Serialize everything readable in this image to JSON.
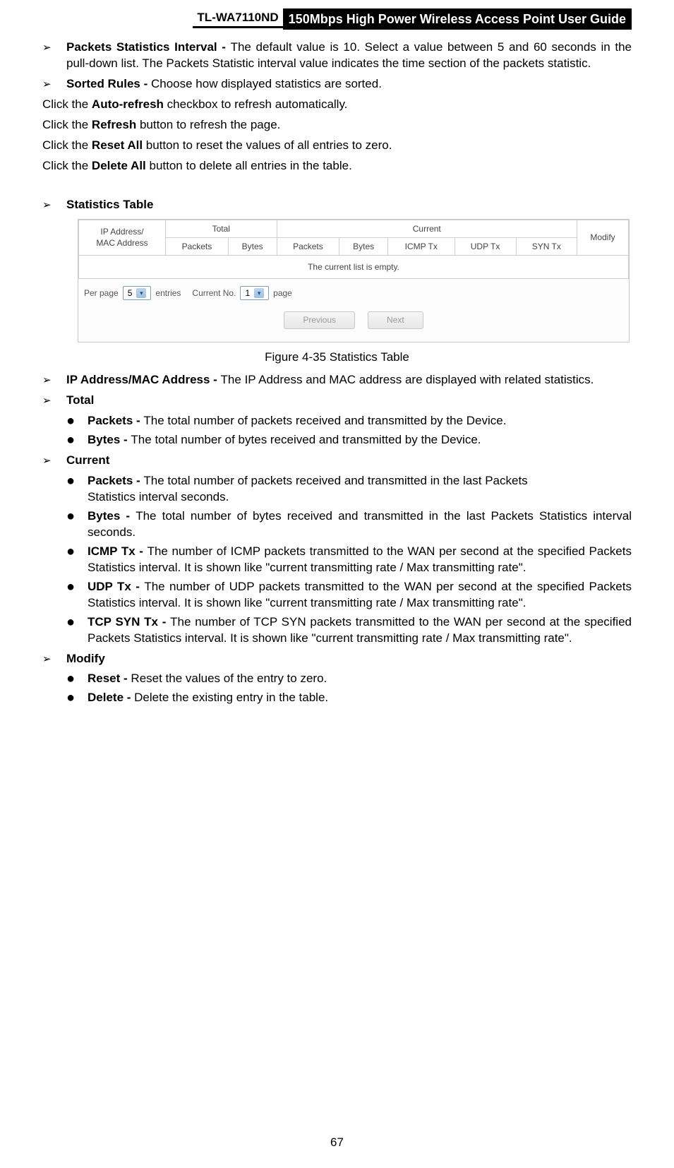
{
  "header": {
    "model": "TL-WA7110ND",
    "title": "150Mbps High Power Wireless Access Point User Guide"
  },
  "items": {
    "pkstats": {
      "label": "Packets  Statistics  Interval  - ",
      "text": "The  default  value  is  10.  Select  a  value  between 5   and    60  seconds  in  the  pull-down  list.  The  Packets  Statistic  interval  value  indicates  the time section of the packets statistic."
    },
    "sorted": {
      "label": "Sorted Rules - ",
      "text": "Choose how displayed statistics are sorted."
    }
  },
  "notes": {
    "autorefresh": {
      "pre": "Click the ",
      "bold": "Auto-refresh",
      "post": " checkbox to refresh automatically."
    },
    "refresh": {
      "pre": "Click the ",
      "bold": "Refresh",
      "post": " button to refresh the page."
    },
    "resetall": {
      "pre": "Click the ",
      "bold": "Reset All",
      "post": " button to reset the values of all entries to zero."
    },
    "deleteall": {
      "pre": "Click the ",
      "bold": "Delete All",
      "post": " button to delete all entries in the table."
    }
  },
  "stats_heading": "Statistics Table",
  "table": {
    "h_ip": "IP Address/\nMAC Address",
    "h_total": "Total",
    "h_current": "Current",
    "h_modify": "Modify",
    "h_packets": "Packets",
    "h_bytes": "Bytes",
    "h_icmp": "ICMP Tx",
    "h_udp": "UDP Tx",
    "h_syn": "SYN Tx",
    "empty": "The current list is empty.",
    "per_page": "Per page",
    "per_page_val": "5",
    "entries": "entries",
    "cur_no": "Current No.",
    "cur_no_val": "1",
    "page": "page",
    "prev": "Previous",
    "next": "Next"
  },
  "figure_caption": "Figure 4-35 Statistics Table",
  "desc": {
    "ipmac": {
      "label": "IP Address/MAC Address - ",
      "text": "The IP Address and MAC address are displayed with related statistics."
    },
    "total_head": "Total",
    "total_packets": {
      "label": "Packets - ",
      "text": "The total number of packets received and transmitted by the Device."
    },
    "total_bytes": {
      "label": "Bytes - ",
      "text": "The total number of bytes received and transmitted by the Device."
    },
    "current_head": "Current",
    "cur_packets": {
      "label": "Packets   -  ",
      "text1": "The   total   number   of   packets   received   and   transmitted   in   the last   Packets",
      "text2": "Statistics interval seconds."
    },
    "cur_bytes": {
      "label": "Bytes - ",
      "text": "The total number of bytes received and transmitted in the last Packets Statistics interval seconds."
    },
    "cur_icmp": {
      "label": "ICMP   Tx   -  ",
      "text": "The   number   of   ICMP   packets   transmitted   to   the   WAN   per second   at   the specified    Packets    Statistics    interval.   It   is   shown   like   \"current transmitting    rate    /    Max transmitting rate\"."
    },
    "cur_udp": {
      "label": "UDP  Tx  -  ",
      "text": "The  number  of  UDP  packets  transmitted  to  the  WAN  per  second  at  the specified Packets   Statistics   interval.   It   is   shown   like   \"current   transmitting   rate   / Max   transmitting rate\"."
    },
    "cur_tcp": {
      "label": "TCP  SYN  Tx  -  ",
      "text": "The  number  of  TCP  SYN  packets  transmitted  to  the  WAN  per  second at  the  specified  Packets  Statistics  interval.  It  is  shown  like  \"current  transmitting  rate  / Max transmitting rate\"."
    },
    "modify_head": "Modify",
    "reset": {
      "label": "Reset - ",
      "text": "Reset the values of the entry to zero."
    },
    "delete": {
      "label": "Delete - ",
      "text": "Delete the existing entry in the table."
    }
  },
  "page_number": "67"
}
